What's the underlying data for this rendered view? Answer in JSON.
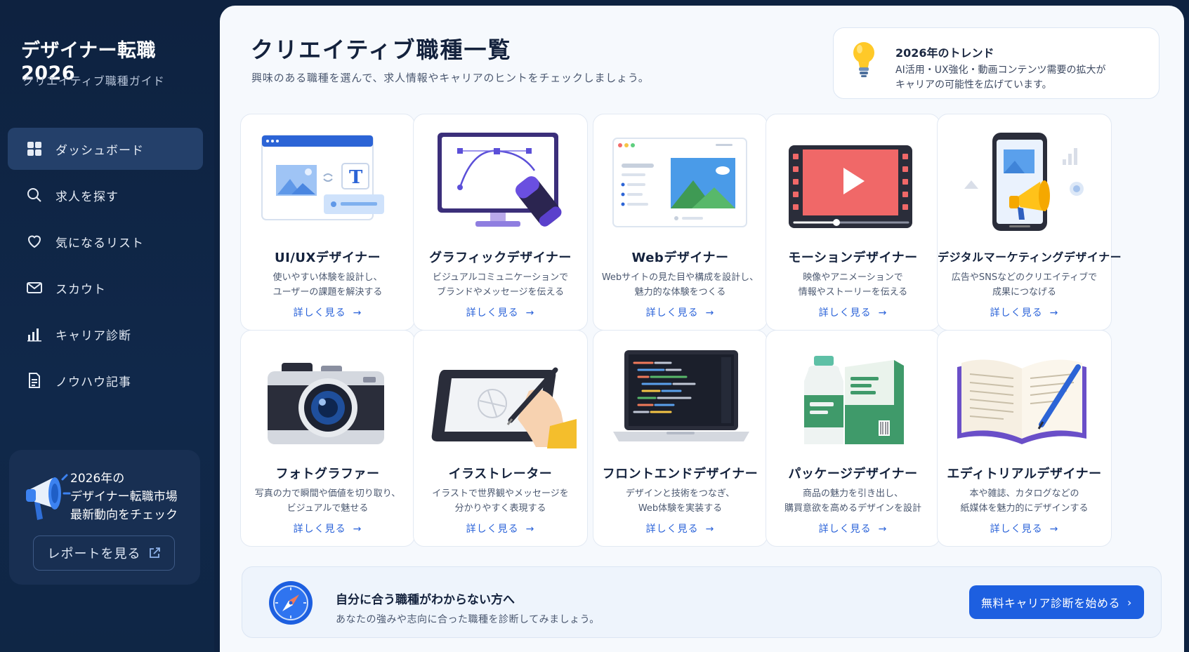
{
  "sidebar": {
    "brand_title": "デザイナー転職 2026",
    "brand_subtitle": "クリエイティブ職種ガイド",
    "items": [
      {
        "label": "ダッシュボード",
        "icon": "grid-icon",
        "active": true
      },
      {
        "label": "求人を探す",
        "icon": "search-icon",
        "active": false
      },
      {
        "label": "気になるリスト",
        "icon": "heart-icon",
        "active": false
      },
      {
        "label": "スカウト",
        "icon": "mail-icon",
        "active": false
      },
      {
        "label": "キャリア診断",
        "icon": "bar-chart-icon",
        "active": false
      },
      {
        "label": "ノウハウ記事",
        "icon": "document-icon",
        "active": false
      }
    ],
    "promo": {
      "line1": "2026年の",
      "line2": "デザイナー転職市場",
      "line3": "最新動向をチェック",
      "button": "レポートを見る",
      "icon": "megaphone-icon",
      "button_icon": "external-link-icon"
    }
  },
  "main": {
    "title": "クリエイティブ職種一覧",
    "description": "興味のある職種を選んで、求人情報やキャリアのヒントをチェックしましょう。",
    "trend": {
      "title": "2026年のトレンド",
      "line1": "AI活用・UX強化・動画コンテンツ需要の拡大が",
      "line2": "キャリアの可能性を広げています。",
      "icon": "lightbulb-icon"
    },
    "cards": [
      {
        "title": "UI/UXデザイナー",
        "desc1": "使いやすい体験を設計し、",
        "desc2": "ユーザーの課題を解決する",
        "link": "詳しく見る",
        "icon": "ui-wireframe-icon"
      },
      {
        "title": "グラフィックデザイナー",
        "desc1": "ビジュアルコミュニケーションで",
        "desc2": "ブランドやメッセージを伝える",
        "link": "詳しく見る",
        "icon": "bezier-monitor-icon"
      },
      {
        "title": "Webデザイナー",
        "desc1": "Webサイトの見た目や構成を設計し、",
        "desc2": "魅力的な体験をつくる",
        "link": "詳しく見る",
        "icon": "browser-window-icon"
      },
      {
        "title": "モーションデザイナー",
        "desc1": "映像やアニメーションで",
        "desc2": "情報やストーリーを伝える",
        "link": "詳しく見る",
        "icon": "video-player-icon"
      },
      {
        "title": "デジタルマーケティングデザイナー",
        "desc1": "広告やSNSなどのクリエイティブで",
        "desc2": "成果につなげる",
        "link": "詳しく見る",
        "icon": "phone-megaphone-icon"
      },
      {
        "title": "フォトグラファー",
        "desc1": "写真の力で瞬間や価値を切り取り、",
        "desc2": "ビジュアルで魅せる",
        "link": "詳しく見る",
        "icon": "camera-icon"
      },
      {
        "title": "イラストレーター",
        "desc1": "イラストで世界観やメッセージを",
        "desc2": "分かりやすく表現する",
        "link": "詳しく見る",
        "icon": "drawing-tablet-icon"
      },
      {
        "title": "フロントエンドデザイナー",
        "desc1": "デザインと技術をつなぎ、",
        "desc2": "Web体験を実装する",
        "link": "詳しく見る",
        "icon": "code-laptop-icon"
      },
      {
        "title": "パッケージデザイナー",
        "desc1": "商品の魅力を引き出し、",
        "desc2": "購買意欲を高めるデザインを設計",
        "link": "詳しく見る",
        "icon": "package-box-icon"
      },
      {
        "title": "エディトリアルデザイナー",
        "desc1": "本や雑誌、カタログなどの",
        "desc2": "紙媒体を魅力的にデザインする",
        "link": "詳しく見る",
        "icon": "open-book-icon"
      }
    ],
    "banner": {
      "title": "自分に合う職種がわからない方へ",
      "text": "あなたの強みや志向に合った職種を診断してみましょう。",
      "button": "無料キャリア診断を始める",
      "icon": "compass-icon"
    }
  },
  "colors": {
    "sidebar_bg": "#0e2240",
    "active_item": "#24406a",
    "accent_blue": "#1d5fe0",
    "link_blue": "#2b63d9",
    "main_bg": "#f6f9fd"
  }
}
